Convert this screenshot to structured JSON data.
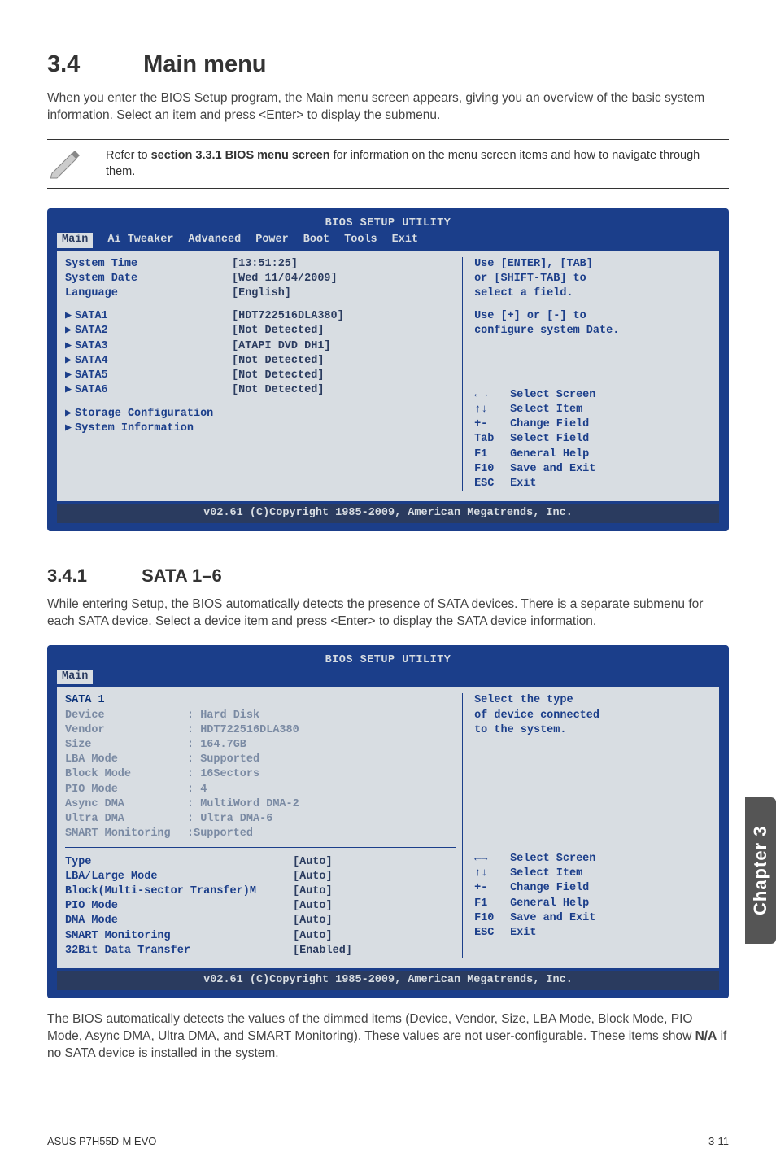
{
  "section": {
    "number": "3.4",
    "title": "Main menu"
  },
  "intro": "When you enter the BIOS Setup program, the Main menu screen appears, giving you an overview of the basic system information. Select an item and press <Enter> to display the submenu.",
  "note": {
    "prefix": "Refer to ",
    "bold": "section 3.3.1 BIOS menu screen",
    "suffix": " for information on the menu screen items and how to navigate through them."
  },
  "bios1": {
    "title": "BIOS SETUP UTILITY",
    "tabs": [
      "Main",
      "Ai Tweaker",
      "Advanced",
      "Power",
      "Boot",
      "Tools",
      "Exit"
    ],
    "active_tab": "Main",
    "left_top": [
      {
        "label": "System Time",
        "value": "[13:51:25]"
      },
      {
        "label": "System Date",
        "value": "[Wed 11/04/2009]"
      },
      {
        "label": "Language",
        "value": "[English]"
      }
    ],
    "sata_items": [
      {
        "label": "SATA1",
        "value": "[HDT722516DLA380]"
      },
      {
        "label": "SATA2",
        "value": "[Not Detected]"
      },
      {
        "label": "SATA3",
        "value": "[ATAPI DVD DH1]"
      },
      {
        "label": "SATA4",
        "value": "[Not Detected]"
      },
      {
        "label": "SATA5",
        "value": "[Not Detected]"
      },
      {
        "label": "SATA6",
        "value": "[Not Detected]"
      }
    ],
    "left_bottom": [
      "Storage Configuration",
      "System Information"
    ],
    "right_top": [
      "Use [ENTER], [TAB]",
      "or [SHIFT-TAB] to",
      "select a field.",
      "",
      "Use [+] or [-] to",
      "configure system Date."
    ],
    "right_nav": [
      {
        "key": "←→",
        "label": "Select Screen"
      },
      {
        "key": "↑↓",
        "label": "Select Item"
      },
      {
        "key": "+-",
        "label": "Change Field"
      },
      {
        "key": "Tab",
        "label": "Select Field"
      },
      {
        "key": "F1",
        "label": "General Help"
      },
      {
        "key": "F10",
        "label": "Save and Exit"
      },
      {
        "key": "ESC",
        "label": "Exit"
      }
    ],
    "footer": "v02.61 (C)Copyright 1985-2009, American Megatrends, Inc."
  },
  "subsection": {
    "number": "3.4.1",
    "title": "SATA 1–6"
  },
  "sata_intro": "While entering Setup, the BIOS automatically detects the presence of SATA devices. There is a separate submenu for each SATA device. Select a device item and press <Enter> to display the SATA device information.",
  "bios2": {
    "title": "BIOS SETUP UTILITY",
    "tabs": [
      "Main"
    ],
    "heading": "SATA 1",
    "dim_rows": [
      {
        "label": "Device",
        "value": ": Hard Disk"
      },
      {
        "label": "Vendor",
        "value": ": HDT722516DLA380"
      },
      {
        "label": "Size",
        "value": ": 164.7GB"
      },
      {
        "label": "LBA Mode",
        "value": ": Supported"
      },
      {
        "label": "Block Mode",
        "value": ": 16Sectors"
      },
      {
        "label": "PIO Mode",
        "value": ": 4"
      },
      {
        "label": "Async DMA",
        "value": ": MultiWord DMA-2"
      },
      {
        "label": "Ultra DMA",
        "value": ": Ultra DMA-6"
      },
      {
        "label": "SMART Monitoring",
        "value": ":Supported"
      }
    ],
    "cfg_rows": [
      {
        "label": "Type",
        "value": "[Auto]"
      },
      {
        "label": "LBA/Large Mode",
        "value": "[Auto]"
      },
      {
        "label": "Block(Multi-sector Transfer)M",
        "value": "[Auto]"
      },
      {
        "label": "PIO Mode",
        "value": "[Auto]"
      },
      {
        "label": "DMA Mode",
        "value": "[Auto]"
      },
      {
        "label": "SMART Monitoring",
        "value": "[Auto]"
      },
      {
        "label": "32Bit Data Transfer",
        "value": "[Enabled]"
      }
    ],
    "right_top": [
      "Select the type",
      "of device connected",
      "to the system."
    ],
    "right_nav": [
      {
        "key": "←→",
        "label": "Select Screen"
      },
      {
        "key": "↑↓",
        "label": "Select Item"
      },
      {
        "key": "+-",
        "label": "Change Field"
      },
      {
        "key": "F1",
        "label": "General Help"
      },
      {
        "key": "F10",
        "label": "Save and Exit"
      },
      {
        "key": "ESC",
        "label": "Exit"
      }
    ],
    "footer": "v02.61 (C)Copyright 1985-2009, American Megatrends, Inc."
  },
  "outro": {
    "text1": "The BIOS automatically detects the values of the dimmed items (Device, Vendor, Size, LBA Mode, Block Mode, PIO Mode, Async DMA, Ultra DMA, and SMART Monitoring). These values are not user-configurable. These items show ",
    "bold": "N/A",
    "text2": " if no SATA device is installed in the system."
  },
  "side_tab": "Chapter 3",
  "footer_left": "ASUS P7H55D-M EVO",
  "footer_right": "3-11"
}
